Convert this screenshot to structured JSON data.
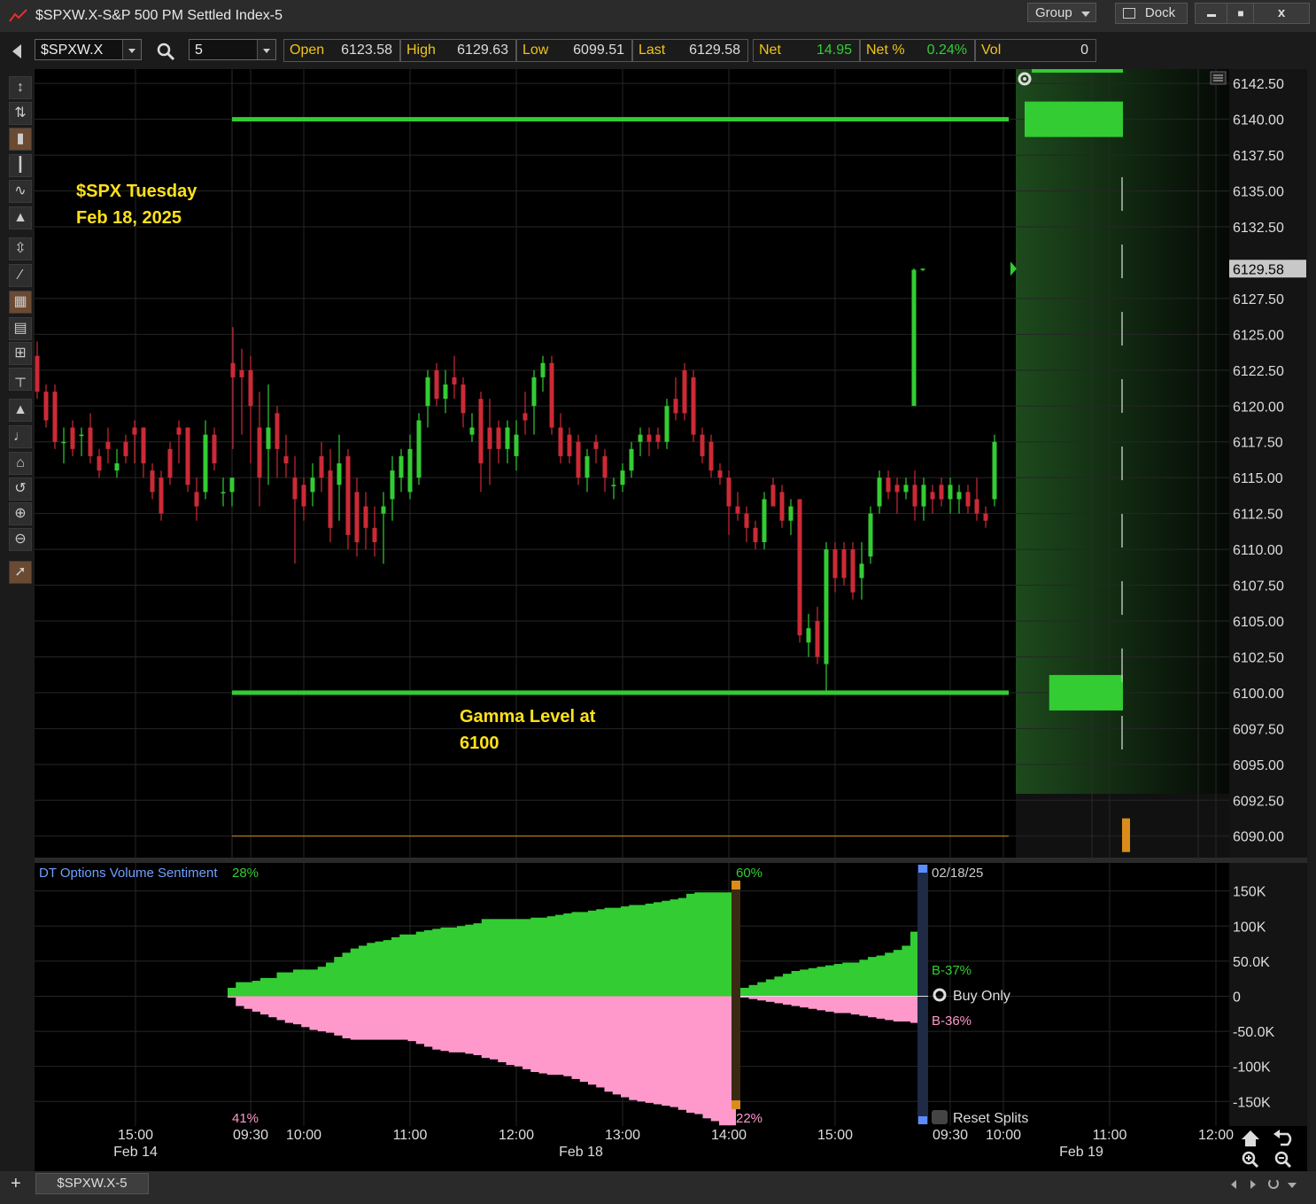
{
  "window": {
    "title": "$SPXW.X-S&P 500 PM Settled Index-5",
    "group_label": "Group",
    "dock_label": "Dock",
    "minimize_label": "▬",
    "maximize_label": "■",
    "close_label": "x"
  },
  "toolbar": {
    "symbol": "$SPXW.X",
    "interval": "5",
    "quote": [
      {
        "label": "Open",
        "value": "6123.58",
        "color": "#dddddd"
      },
      {
        "label": "High",
        "value": "6129.63",
        "color": "#dddddd"
      },
      {
        "label": "Low",
        "value": "6099.51",
        "color": "#dddddd"
      },
      {
        "label": "Last",
        "value": "6129.58",
        "color": "#dddddd"
      },
      {
        "label": "Net",
        "value": "14.95",
        "color": "#33cc33"
      },
      {
        "label": "Net %",
        "value": "0.24%",
        "color": "#33cc33"
      },
      {
        "label": "Vol",
        "value": "0",
        "color": "#dddddd"
      }
    ]
  },
  "left_tools": [
    "cursor-cross-icon",
    "crosshair-icon",
    "candlestick-icon",
    "bar-chart-icon",
    "line-chart-icon",
    "mountain-chart-icon",
    "fit-vertical-icon",
    "trendline-icon",
    "grid-icon",
    "table-icon",
    "mini-table-icon",
    "fibonacci-icon",
    "drag-up-icon",
    "drag-down-icon",
    "home-icon",
    "undo-icon",
    "zoom-in-icon",
    "zoom-out-icon",
    "pointer-icon"
  ],
  "annotations": {
    "title_line1": "$SPX Tuesday",
    "title_line2": "Feb 18, 2025",
    "gamma_line1": "Gamma Level at",
    "gamma_line2": "6100"
  },
  "chart_data": [
    {
      "type": "candlestick",
      "title": "$SPXW.X-S&P 500 PM Settled Index-5",
      "interval_minutes": 5,
      "ylim": [
        6088.5,
        6143.5
      ],
      "y_ticks": [
        "6142.50",
        "6140.00",
        "6137.50",
        "6135.00",
        "6132.50",
        "6129.58",
        "6127.50",
        "6125.00",
        "6122.50",
        "6120.00",
        "6117.50",
        "6115.00",
        "6112.50",
        "6110.00",
        "6107.50",
        "6105.00",
        "6102.50",
        "6100.00",
        "6097.50",
        "6095.00",
        "6092.50",
        "6090.00"
      ],
      "last_price_label": "6129.58",
      "x_ticks": [
        {
          "time": "15:00",
          "date": "Feb 14"
        },
        {
          "time": "09:30"
        },
        {
          "time": "10:00"
        },
        {
          "time": "11:00"
        },
        {
          "time": "12:00"
        },
        {
          "time": "13:00"
        },
        {
          "time": "14:00"
        },
        {
          "time": "15:00"
        },
        {
          "time": "09:30"
        },
        {
          "time": "10:00"
        },
        {
          "time": "11:00",
          "date": "Feb 19"
        },
        {
          "time": "12:00"
        }
      ],
      "date_label_middle": "Feb 18",
      "levels": [
        {
          "price": 6140.0,
          "color": "#33cc33"
        },
        {
          "price": 6100.0,
          "color": "#33cc33"
        },
        {
          "price": 6090.0,
          "color": "#d98c1a"
        }
      ],
      "feb14_candles": [
        [
          6123.5,
          6124.5,
          6120.5,
          6121.0
        ],
        [
          6121.0,
          6121.5,
          6118.5,
          6119.0
        ],
        [
          6121.0,
          6121.5,
          6117.0,
          6117.5
        ],
        [
          6117.5,
          6118.5,
          6116.0,
          6117.5
        ],
        [
          6118.5,
          6119.0,
          6116.5,
          6117.0
        ],
        [
          6118.0,
          6118.5,
          6116.5,
          6118.0
        ],
        [
          6118.5,
          6119.5,
          6116.0,
          6116.5
        ],
        [
          6116.5,
          6117.0,
          6115.0,
          6115.5
        ],
        [
          6117.5,
          6118.5,
          6116.0,
          6117.0
        ],
        [
          6115.5,
          6117.0,
          6115.0,
          6116.0
        ],
        [
          6117.5,
          6118.0,
          6116.0,
          6116.5
        ],
        [
          6118.5,
          6119.0,
          6116.0,
          6118.0
        ],
        [
          6118.5,
          6118.5,
          6115.0,
          6116.0
        ],
        [
          6115.5,
          6116.0,
          6113.5,
          6114.0
        ],
        [
          6115.0,
          6115.5,
          6112.0,
          6112.5
        ],
        [
          6117.0,
          6117.5,
          6114.5,
          6115.0
        ],
        [
          6118.5,
          6119.0,
          6116.0,
          6118.0
        ],
        [
          6118.5,
          6118.5,
          6114.0,
          6114.5
        ],
        [
          6114.0,
          6115.0,
          6112.0,
          6113.0
        ],
        [
          6114.0,
          6119.0,
          6113.5,
          6118.0
        ],
        [
          6118.0,
          6118.5,
          6115.5,
          6116.0
        ],
        [
          6114.0,
          6115.0,
          6113.0,
          6114.0
        ],
        [
          6114.0,
          6115.0,
          6113.0,
          6115.0
        ]
      ],
      "feb18_candles": [
        [
          6123.0,
          6125.5,
          6117.0,
          6122.0
        ],
        [
          6122.5,
          6124.0,
          6118.0,
          6122.0
        ],
        [
          6122.5,
          6123.5,
          6116.0,
          6120.0
        ],
        [
          6118.5,
          6121.0,
          6113.0,
          6115.0
        ],
        [
          6117.0,
          6121.5,
          6114.5,
          6118.5
        ],
        [
          6119.5,
          6120.0,
          6115.0,
          6117.0
        ],
        [
          6116.5,
          6118.0,
          6115.0,
          6116.0
        ],
        [
          6115.0,
          6116.5,
          6109.0,
          6113.5
        ],
        [
          6114.5,
          6115.0,
          6112.0,
          6113.0
        ],
        [
          6114.0,
          6116.0,
          6113.0,
          6115.0
        ],
        [
          6116.5,
          6117.5,
          6114.0,
          6115.0
        ],
        [
          6115.5,
          6117.0,
          6110.5,
          6111.5
        ],
        [
          6114.5,
          6118.0,
          6112.0,
          6116.0
        ],
        [
          6116.5,
          6117.0,
          6110.0,
          6111.0
        ],
        [
          6114.0,
          6115.0,
          6109.5,
          6110.5
        ],
        [
          6113.0,
          6114.0,
          6110.0,
          6111.5
        ],
        [
          6111.5,
          6113.0,
          6109.5,
          6110.5
        ],
        [
          6112.5,
          6114.0,
          6109.0,
          6113.0
        ],
        [
          6113.5,
          6116.5,
          6112.0,
          6115.5
        ],
        [
          6115.0,
          6117.0,
          6114.0,
          6116.5
        ],
        [
          6114.0,
          6118.0,
          6113.5,
          6117.0
        ],
        [
          6115.0,
          6119.5,
          6114.5,
          6119.0
        ],
        [
          6120.0,
          6122.5,
          6118.5,
          6122.0
        ],
        [
          6122.5,
          6123.0,
          6120.0,
          6120.5
        ],
        [
          6120.5,
          6122.5,
          6119.5,
          6121.5
        ],
        [
          6122.0,
          6123.5,
          6120.5,
          6121.5
        ],
        [
          6121.5,
          6122.0,
          6118.5,
          6119.5
        ],
        [
          6118.0,
          6119.5,
          6117.5,
          6118.5
        ],
        [
          6120.5,
          6121.0,
          6114.0,
          6116.0
        ],
        [
          6118.5,
          6120.5,
          6114.5,
          6117.0
        ],
        [
          6118.5,
          6119.0,
          6116.0,
          6117.0
        ],
        [
          6117.0,
          6119.0,
          6116.0,
          6118.5
        ],
        [
          6116.5,
          6119.0,
          6115.5,
          6118.0
        ],
        [
          6119.5,
          6121.0,
          6118.0,
          6119.0
        ],
        [
          6120.0,
          6122.5,
          6118.0,
          6122.0
        ],
        [
          6122.0,
          6123.5,
          6121.0,
          6123.0
        ],
        [
          6123.0,
          6123.5,
          6118.0,
          6118.5
        ],
        [
          6118.5,
          6119.5,
          6116.0,
          6116.5
        ],
        [
          6118.0,
          6118.5,
          6116.0,
          6116.5
        ],
        [
          6117.5,
          6118.0,
          6114.5,
          6115.0
        ],
        [
          6115.0,
          6117.0,
          6114.0,
          6116.5
        ],
        [
          6117.5,
          6118.0,
          6116.0,
          6117.0
        ],
        [
          6116.5,
          6117.0,
          6114.0,
          6115.0
        ],
        [
          6114.5,
          6115.0,
          6113.5,
          6114.5
        ],
        [
          6114.5,
          6116.0,
          6114.0,
          6115.5
        ],
        [
          6115.5,
          6117.5,
          6115.0,
          6117.0
        ],
        [
          6117.5,
          6118.5,
          6116.5,
          6118.0
        ],
        [
          6118.0,
          6118.5,
          6116.5,
          6117.5
        ],
        [
          6118.0,
          6118.5,
          6117.0,
          6117.5
        ],
        [
          6117.5,
          6120.5,
          6117.0,
          6120.0
        ],
        [
          6120.5,
          6122.0,
          6119.0,
          6119.5
        ],
        [
          6122.5,
          6123.0,
          6119.0,
          6119.5
        ],
        [
          6122.0,
          6122.5,
          6117.5,
          6118.0
        ],
        [
          6118.0,
          6118.5,
          6116.0,
          6116.5
        ],
        [
          6117.5,
          6118.0,
          6115.0,
          6115.5
        ],
        [
          6115.5,
          6116.0,
          6114.5,
          6115.0
        ],
        [
          6115.0,
          6115.5,
          6111.0,
          6113.0
        ],
        [
          6113.0,
          6114.0,
          6112.0,
          6112.5
        ],
        [
          6112.5,
          6113.0,
          6110.5,
          6111.5
        ],
        [
          6111.5,
          6112.0,
          6110.0,
          6110.5
        ],
        [
          6110.5,
          6114.0,
          6110.0,
          6113.5
        ],
        [
          6114.5,
          6115.0,
          6113.0,
          6113.0
        ],
        [
          6114.0,
          6114.5,
          6111.5,
          6112.0
        ],
        [
          6112.0,
          6113.5,
          6111.0,
          6113.0
        ],
        [
          6113.5,
          6113.0,
          6103.5,
          6104.0
        ],
        [
          6103.5,
          6105.5,
          6102.5,
          6104.5
        ],
        [
          6105.0,
          6106.0,
          6102.0,
          6102.5
        ],
        [
          6102.0,
          6110.5,
          6100.0,
          6110.0
        ],
        [
          6110.0,
          6110.5,
          6107.0,
          6108.0
        ],
        [
          6110.0,
          6110.5,
          6107.5,
          6108.0
        ],
        [
          6110.0,
          6110.5,
          6106.5,
          6107.0
        ],
        [
          6108.0,
          6110.5,
          6106.5,
          6109.0
        ],
        [
          6109.5,
          6113.0,
          6109.0,
          6112.5
        ],
        [
          6113.0,
          6115.5,
          6112.5,
          6115.0
        ],
        [
          6115.0,
          6115.5,
          6113.5,
          6114.0
        ],
        [
          6114.5,
          6115.0,
          6112.5,
          6114.0
        ],
        [
          6114.0,
          6115.0,
          6113.5,
          6114.5
        ],
        [
          6114.5,
          6115.5,
          6112.0,
          6113.0
        ],
        [
          6113.0,
          6115.0,
          6112.0,
          6114.5
        ],
        [
          6114.0,
          6114.5,
          6112.5,
          6113.5
        ],
        [
          6114.5,
          6115.0,
          6113.0,
          6113.5
        ],
        [
          6113.5,
          6115.0,
          6112.5,
          6114.5
        ],
        [
          6113.5,
          6114.5,
          6112.5,
          6114.0
        ],
        [
          6114.0,
          6114.5,
          6112.5,
          6113.0
        ],
        [
          6113.5,
          6115.0,
          6112.0,
          6112.5
        ],
        [
          6112.5,
          6113.0,
          6111.5,
          6112.0
        ],
        [
          6113.5,
          6118.0,
          6113.0,
          6117.5
        ],
        [
          6120.0,
          6129.6,
          6120.0,
          6129.5
        ],
        [
          6129.5,
          6129.6,
          6129.4,
          6129.58
        ]
      ],
      "volume_profile": [
        {
          "price": 6140.0,
          "side": "call",
          "size": 1.0
        },
        {
          "price": 6100.0,
          "side": "call",
          "size": 0.75
        },
        {
          "price": 6090.0,
          "side": "put",
          "size": 0.05
        }
      ]
    },
    {
      "type": "area",
      "title": "DT Options Volume Sentiment",
      "ylim": [
        -185000,
        190000
      ],
      "y_ticks": [
        "150K",
        "100K",
        "50.0K",
        "0",
        "-50.0K",
        "-100K",
        "-150K"
      ],
      "series": [
        {
          "color": "#33cc33",
          "values": [
            12000,
            20000,
            20000,
            22000,
            26000,
            26000,
            34000,
            34000,
            38000,
            38000,
            38000,
            42000,
            48000,
            56000,
            62000,
            68000,
            72000,
            76000,
            78000,
            80000,
            84000,
            88000,
            88000,
            92000,
            94000,
            96000,
            98000,
            98000,
            100000,
            102000,
            104000,
            110000,
            110000,
            110000,
            110000,
            110000,
            110000,
            112000,
            112000,
            114000,
            116000,
            118000,
            120000,
            120000,
            122000,
            124000,
            126000,
            126000,
            128000,
            130000,
            130000,
            132000,
            134000,
            136000,
            138000,
            140000,
            146000,
            148000,
            148000,
            148000,
            148000,
            148000
          ]
        },
        {
          "color": "#ff99cc",
          "values": [
            -2000,
            -14000,
            -18000,
            -22000,
            -26000,
            -30000,
            -34000,
            -38000,
            -40000,
            -44000,
            -48000,
            -50000,
            -52000,
            -56000,
            -60000,
            -62000,
            -62000,
            -62000,
            -62000,
            -62000,
            -62000,
            -62000,
            -64000,
            -68000,
            -72000,
            -76000,
            -78000,
            -80000,
            -80000,
            -82000,
            -84000,
            -88000,
            -90000,
            -94000,
            -98000,
            -100000,
            -104000,
            -108000,
            -110000,
            -112000,
            -112000,
            -114000,
            -118000,
            -122000,
            -126000,
            -130000,
            -136000,
            -140000,
            -144000,
            -148000,
            -150000,
            -152000,
            -154000,
            -156000,
            -158000,
            -162000,
            -166000,
            -168000,
            -174000,
            -178000,
            -184000,
            -184000
          ]
        },
        {
          "color": "#33cc33",
          "values": [
            12000,
            16000,
            20000,
            24000,
            28000,
            32000,
            36000,
            38000,
            40000,
            42000,
            44000,
            46000,
            48000,
            48000,
            52000,
            56000,
            58000,
            62000,
            66000,
            72000,
            92000,
            122000
          ]
        },
        {
          "color": "#ff99cc",
          "values": [
            -2000,
            -4000,
            -6000,
            -8000,
            -10000,
            -12000,
            -14000,
            -16000,
            -18000,
            -20000,
            -22000,
            -24000,
            -24000,
            -26000,
            -28000,
            -30000,
            -32000,
            -34000,
            -36000,
            -36000,
            -38000,
            -38000
          ]
        }
      ],
      "labels": {
        "top_left_pct": "28%",
        "bottom_left_pct": "41%",
        "top_mid_pct": "60%",
        "bottom_mid_pct": "22%",
        "date": "02/18/25",
        "buy_pct": "B-37%",
        "sell_pct": "B-36%",
        "buy_only": "Buy Only",
        "reset_splits": "Reset Splits"
      }
    }
  ],
  "statusbar": {
    "tab_label": "$SPXW.X-5",
    "add_label": "+"
  },
  "colors": {
    "up": "#33cc33",
    "down": "#cc2a36",
    "annotation": "#ffe119",
    "gamma": "#33cc33"
  }
}
